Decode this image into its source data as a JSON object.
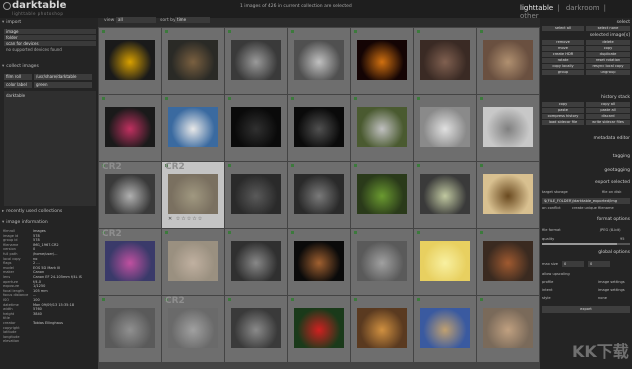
{
  "app": {
    "name": "darktable",
    "subtitle": "lighttable photoshop"
  },
  "top_status": "1 images of 426 in current collection are selected",
  "views": [
    "lighttable",
    "darkroom",
    "other"
  ],
  "active_view": "lighttable",
  "toolbar": {
    "view_label": "view",
    "view_value": "all",
    "sortby_label": "sort by",
    "sortby_value": "time"
  },
  "left": {
    "import_head": "import",
    "import_items": [
      "image",
      "folder",
      "scan for devices",
      "no supported devices found"
    ],
    "collect_head": "collect images",
    "collect_rows": [
      {
        "label": "film roll",
        "value": "/usr/share/darktable"
      },
      {
        "label": "color label",
        "value": "green"
      }
    ],
    "collect_extra": "darktable",
    "recent_head": "recently used collections",
    "info_head": "image information",
    "info": [
      [
        "filmroll",
        "images"
      ],
      [
        "image id",
        "578"
      ],
      [
        "group id",
        "578"
      ],
      [
        "filename",
        "IMG_1967.CR2"
      ],
      [
        "version",
        "0"
      ],
      [
        "full path",
        "/home/user/..."
      ],
      [
        "local copy",
        "no"
      ],
      [
        "flags",
        "  2  ..."
      ],
      [
        "model",
        "EOS 5D Mark III"
      ],
      [
        "maker",
        "Canon"
      ],
      [
        "lens",
        "Canon EF 24-105mm f/4L IS"
      ],
      [
        "aperture",
        "f/4.0"
      ],
      [
        "exposure",
        "1/1250"
      ],
      [
        "focal length",
        "105 mm"
      ],
      [
        "focus distance",
        "..."
      ],
      [
        "ISO",
        "100"
      ],
      [
        "datetime",
        "Mon 09/09/13 15:35:18"
      ],
      [
        "width",
        "5760"
      ],
      [
        "height",
        "3840"
      ],
      [
        "title",
        ""
      ],
      [
        "creator",
        "Tobias Ellinghaus"
      ],
      [
        "copyright",
        ""
      ],
      [
        "latitude",
        ""
      ],
      [
        "longitude",
        ""
      ],
      [
        "elevation",
        ""
      ]
    ]
  },
  "right": {
    "select_head": "select",
    "selected_head": "selected image[s]",
    "select_buttons": [
      "select all",
      "select none",
      "invert selection",
      "select film roll",
      "select untouched"
    ],
    "selected_buttons": [
      "remove",
      "delete",
      "move",
      "copy",
      "create HDR",
      "duplicate",
      "rotate",
      "reset rotation",
      "copy locally",
      "resync local copy",
      "group",
      "ungroup"
    ],
    "history_head": "history stack",
    "history_buttons": [
      "copy",
      "copy all",
      "paste",
      "paste all",
      "compress history",
      "discard",
      "load sidecar file",
      "write sidecar files"
    ],
    "metadata_head": "metadata editor",
    "tagging_head": "tagging",
    "geotagging_head": "geotagging",
    "export_head": "export selected",
    "target_storage_label": "target storage",
    "target_storage_value": "file on disk",
    "export_path": "$(FILE_FOLDER)/darktable_exported/img",
    "on_conflict_label": "on conflict",
    "on_conflict_value": "create unique filename",
    "format_head": "format options",
    "file_format_label": "file format",
    "file_format_value": "JPEG (8-bit)",
    "quality_label": "quality",
    "quality_value": "95",
    "global_head": "global options",
    "max_size_label": "max size",
    "max_size_value": "0",
    "allow_upscaling": "allow upscaling",
    "profile_label": "profile",
    "profile_value": "image settings",
    "intent_label": "intent",
    "intent_value": "image settings",
    "style_label": "style",
    "style_value": "none",
    "export_button": "export"
  },
  "watermark": "KK下载",
  "thumbnails": [
    [
      "#1a1a1a",
      "#d8a000"
    ],
    [
      "#2a2a26",
      "#7a6040"
    ],
    [
      "#3a3a3a",
      "#9a9a9a"
    ],
    [
      "#505050",
      "#c0c0c0"
    ],
    [
      "#140404",
      "#d07010"
    ],
    [
      "#3a2a24",
      "#806050"
    ],
    [
      "#6a5040",
      "#b09070"
    ],
    [
      "#1a1a1a",
      "#c03060"
    ],
    [
      "#3a6aa0",
      "#e8e8e8"
    ],
    [
      "#0a0a0a",
      "#303030"
    ],
    [
      "#0a0a0a",
      "#505050"
    ],
    [
      "#4a5a30",
      "#c0c0c0"
    ],
    [
      "#8a8a8a",
      "#e0e0e0"
    ],
    [
      "#c8c8c8",
      "#808080"
    ],
    [
      "#3a3a3a",
      "#b0b0b0"
    ],
    [
      "#7a7060",
      "#a09880"
    ],
    [
      "#2a2a2a",
      "#5a5a5a"
    ],
    [
      "#2a2a2a",
      "#7a7a7a"
    ],
    [
      "#2a3a1a",
      "#6a9a30"
    ],
    [
      "#3a3a3a",
      "#c0c8a0"
    ],
    [
      "#d8c090",
      "#6a4a20"
    ],
    [
      "#3a3a6a",
      "#c050a0"
    ],
    [
      "#9a9080",
      "#c0b0a0"
    ],
    [
      "#303030",
      "#888888"
    ],
    [
      "#0a0a0a",
      "#a06030"
    ],
    [
      "#5a5a5a",
      "#a0a0a0"
    ],
    [
      "#e8d060",
      "#f8f0a0"
    ],
    [
      "#3a2a20",
      "#a05a30"
    ],
    [
      "#5a5a5a",
      "#909090"
    ],
    [
      "#6a6a6a",
      "#a0a0a0"
    ],
    [
      "#3a3a3a",
      "#8a8a8a"
    ],
    [
      "#1a3a1a",
      "#d02020"
    ],
    [
      "#5a3a20",
      "#d09040"
    ],
    [
      "#3a5aa0",
      "#c0a070"
    ],
    [
      "#7a6a5a",
      "#c0a080"
    ]
  ]
}
